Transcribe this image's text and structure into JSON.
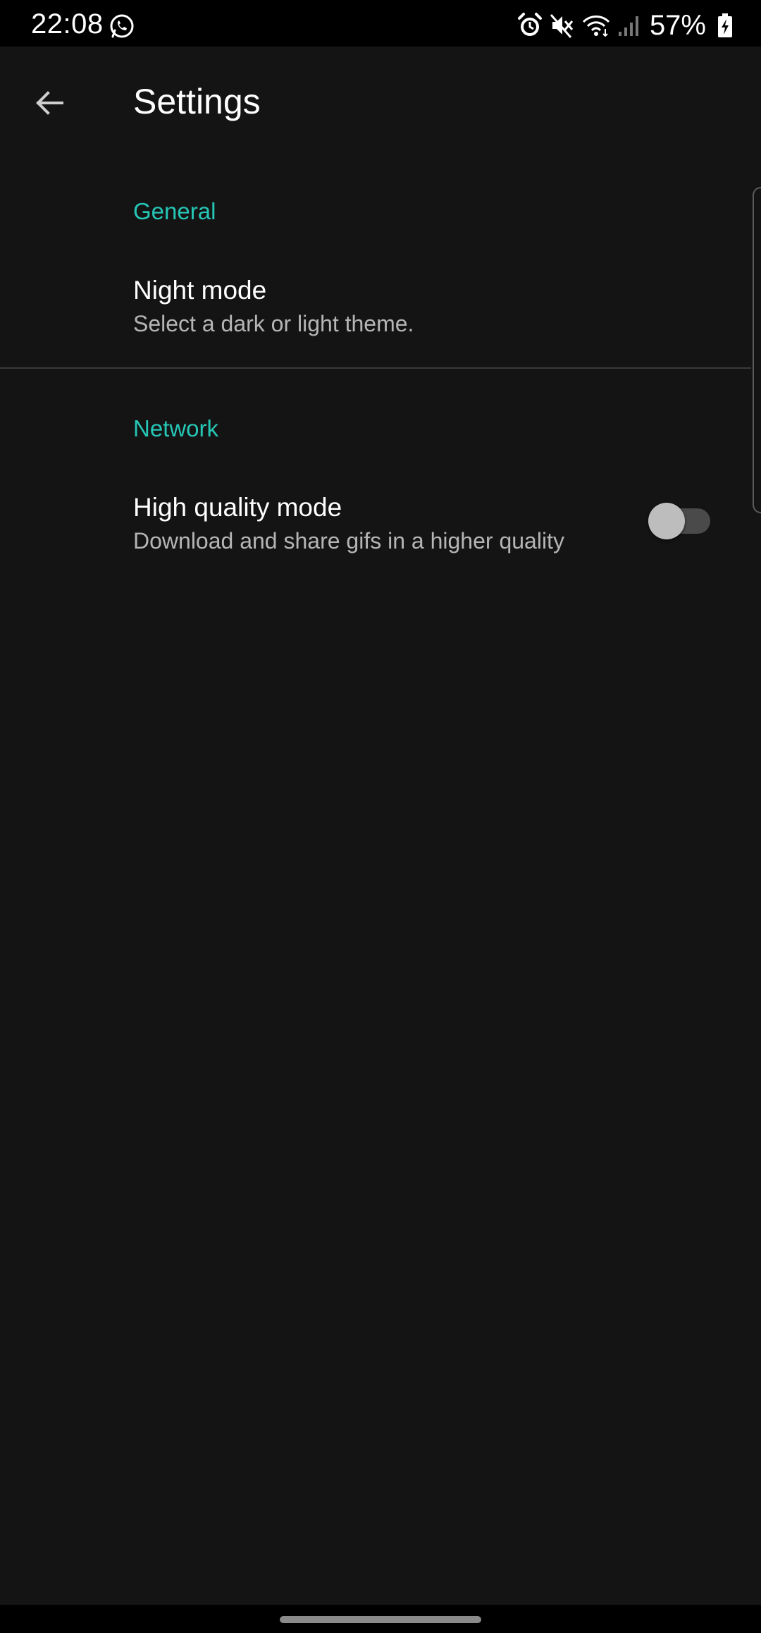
{
  "status_bar": {
    "time": "22:08",
    "battery": "57%",
    "icons": [
      "whatsapp-icon",
      "alarm-icon",
      "mute-icon",
      "wifi-icon",
      "signal-icon",
      "battery-charging-icon"
    ]
  },
  "toolbar": {
    "title": "Settings",
    "back_icon": "arrow-back-icon"
  },
  "sections": [
    {
      "header": "General",
      "items": [
        {
          "title": "Night mode",
          "summary": "Select a dark or light theme."
        }
      ]
    },
    {
      "header": "Network",
      "items": [
        {
          "title": "High quality mode",
          "summary": "Download and share gifs in a higher quality",
          "switch_on": false
        }
      ]
    }
  ],
  "colors": {
    "accent": "#26c6b5",
    "background": "#141414",
    "text_primary": "#ffffff",
    "text_secondary": "#b5b5b5"
  }
}
